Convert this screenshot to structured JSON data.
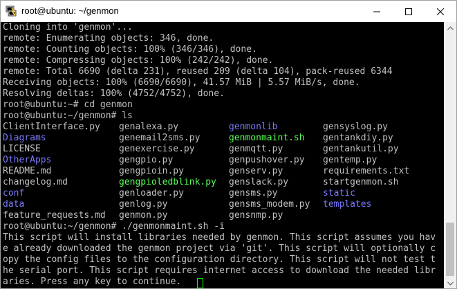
{
  "window": {
    "title": "root@ubuntu: ~/genmon",
    "icon": "putty-icon",
    "controls": [
      "minimize-icon",
      "maximize-icon",
      "close-icon"
    ]
  },
  "colors": {
    "background": "#000000",
    "text": "#c0c0c0",
    "directory": "#7a7aff",
    "executable": "#55ff55",
    "cursor": "#00ff00"
  },
  "terminal": {
    "before": [
      "Cloning into 'genmon'...",
      "remote: Enumerating objects: 346, done.",
      "remote: Counting objects: 100% (346/346), done.",
      "remote: Compressing objects: 100% (242/242), done.",
      "remote: Total 6690 (delta 231), reused 209 (delta 104), pack-reused 6344",
      "Receiving objects: 100% (6690/6690), 41.57 MiB | 5.57 MiB/s, done.",
      "Resolving deltas: 100% (4752/4752), done.",
      "root@ubuntu:~# cd genmon",
      "root@ubuntu:~/genmon# ls"
    ],
    "ls_columns": [
      [
        {
          "name": "ClientInterface.py",
          "type": "file"
        },
        {
          "name": "Diagrams",
          "type": "dir"
        },
        {
          "name": "LICENSE",
          "type": "file"
        },
        {
          "name": "OtherApps",
          "type": "dir"
        },
        {
          "name": "README.md",
          "type": "file"
        },
        {
          "name": "changelog.md",
          "type": "file"
        },
        {
          "name": "conf",
          "type": "dir"
        },
        {
          "name": "data",
          "type": "dir"
        },
        {
          "name": "feature_requests.md",
          "type": "file"
        }
      ],
      [
        {
          "name": "genalexa.py",
          "type": "file"
        },
        {
          "name": "genemail2sms.py",
          "type": "file"
        },
        {
          "name": "genexercise.py",
          "type": "file"
        },
        {
          "name": "gengpio.py",
          "type": "file"
        },
        {
          "name": "gengpioin.py",
          "type": "file"
        },
        {
          "name": "gengpioledblink.py",
          "type": "exec"
        },
        {
          "name": "genloader.py",
          "type": "file"
        },
        {
          "name": "genlog.py",
          "type": "file"
        },
        {
          "name": "genmon.py",
          "type": "file"
        }
      ],
      [
        {
          "name": "genmonlib",
          "type": "dir"
        },
        {
          "name": "genmonmaint.sh",
          "type": "exec"
        },
        {
          "name": "genmqtt.py",
          "type": "file"
        },
        {
          "name": "genpushover.py",
          "type": "file"
        },
        {
          "name": "genserv.py",
          "type": "file"
        },
        {
          "name": "genslack.py",
          "type": "file"
        },
        {
          "name": "gensms.py",
          "type": "file"
        },
        {
          "name": "gensms_modem.py",
          "type": "file"
        },
        {
          "name": "gensnmp.py",
          "type": "file"
        }
      ],
      [
        {
          "name": "gensyslog.py",
          "type": "file"
        },
        {
          "name": "gentankdiy.py",
          "type": "file"
        },
        {
          "name": "gentankutil.py",
          "type": "file"
        },
        {
          "name": "gentemp.py",
          "type": "file"
        },
        {
          "name": "requirements.txt",
          "type": "file"
        },
        {
          "name": "startgenmon.sh",
          "type": "file"
        },
        {
          "name": "static",
          "type": "dir"
        },
        {
          "name": "templates",
          "type": "dir"
        }
      ]
    ],
    "after": [
      "root@ubuntu:~/genmon# ./genmonmaint.sh -i",
      "This script will install libraries needed by genmon. This script assumes you hav",
      "e already downloaded the genmon project via 'git'. This script will optionally c",
      "opy the config files to the configuration directory. This script will not test t",
      "he serial port. This script requires internet access to download the needed libr",
      "aries. Press any key to continue."
    ]
  },
  "scrollbar": {
    "icons": [
      "scroll-up-icon",
      "scroll-down-icon"
    ],
    "position": 0.97
  }
}
